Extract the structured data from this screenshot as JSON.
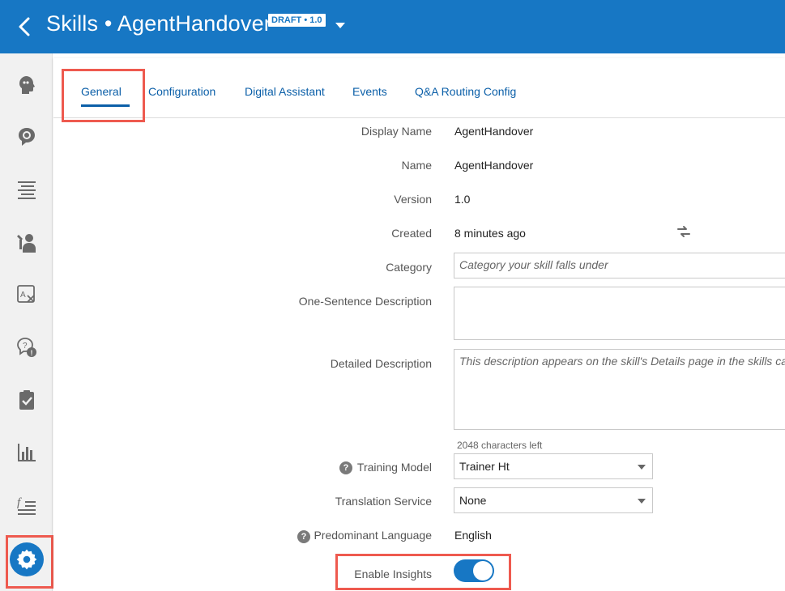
{
  "header": {
    "title": "Skills • AgentHandover",
    "badge": "DRAFT • 1.0",
    "bg_color": "#1777c4"
  },
  "rail": {
    "icons": [
      "intents-icon",
      "entities-icon",
      "flows-icon",
      "components-icon",
      "resource-bundles-icon",
      "quality-icon",
      "test-cases-icon",
      "insights-icon",
      "variables-icon",
      "settings-icon"
    ],
    "active": "settings-icon"
  },
  "tabs": [
    {
      "label": "General",
      "active": true
    },
    {
      "label": "Configuration"
    },
    {
      "label": "Digital Assistant"
    },
    {
      "label": "Events"
    },
    {
      "label": "Q&A Routing Config"
    }
  ],
  "form": {
    "display_name_label": "Display Name",
    "display_name_value": "AgentHandover",
    "name_label": "Name",
    "name_value": "AgentHandover",
    "version_label": "Version",
    "version_value": "1.0",
    "created_label": "Created",
    "created_value": "8 minutes ago",
    "category_label": "Category",
    "category_placeholder": "Category your skill falls under",
    "one_sentence_label": "One-Sentence Description",
    "one_sentence_value": "",
    "detailed_label": "Detailed Description",
    "detailed_placeholder": "This description appears on the skill's Details page in the skills cata",
    "chars_left": "2048 characters left",
    "training_model_label": "Training Model",
    "training_model_value": "Trainer Ht",
    "translation_label": "Translation Service",
    "translation_value": "None",
    "language_label": "Predominant Language",
    "language_value": "English",
    "insights_label": "Enable Insights",
    "insights_enabled": true
  },
  "accent_color": "#0b5fa8",
  "highlight_color": "#ee5a4f"
}
